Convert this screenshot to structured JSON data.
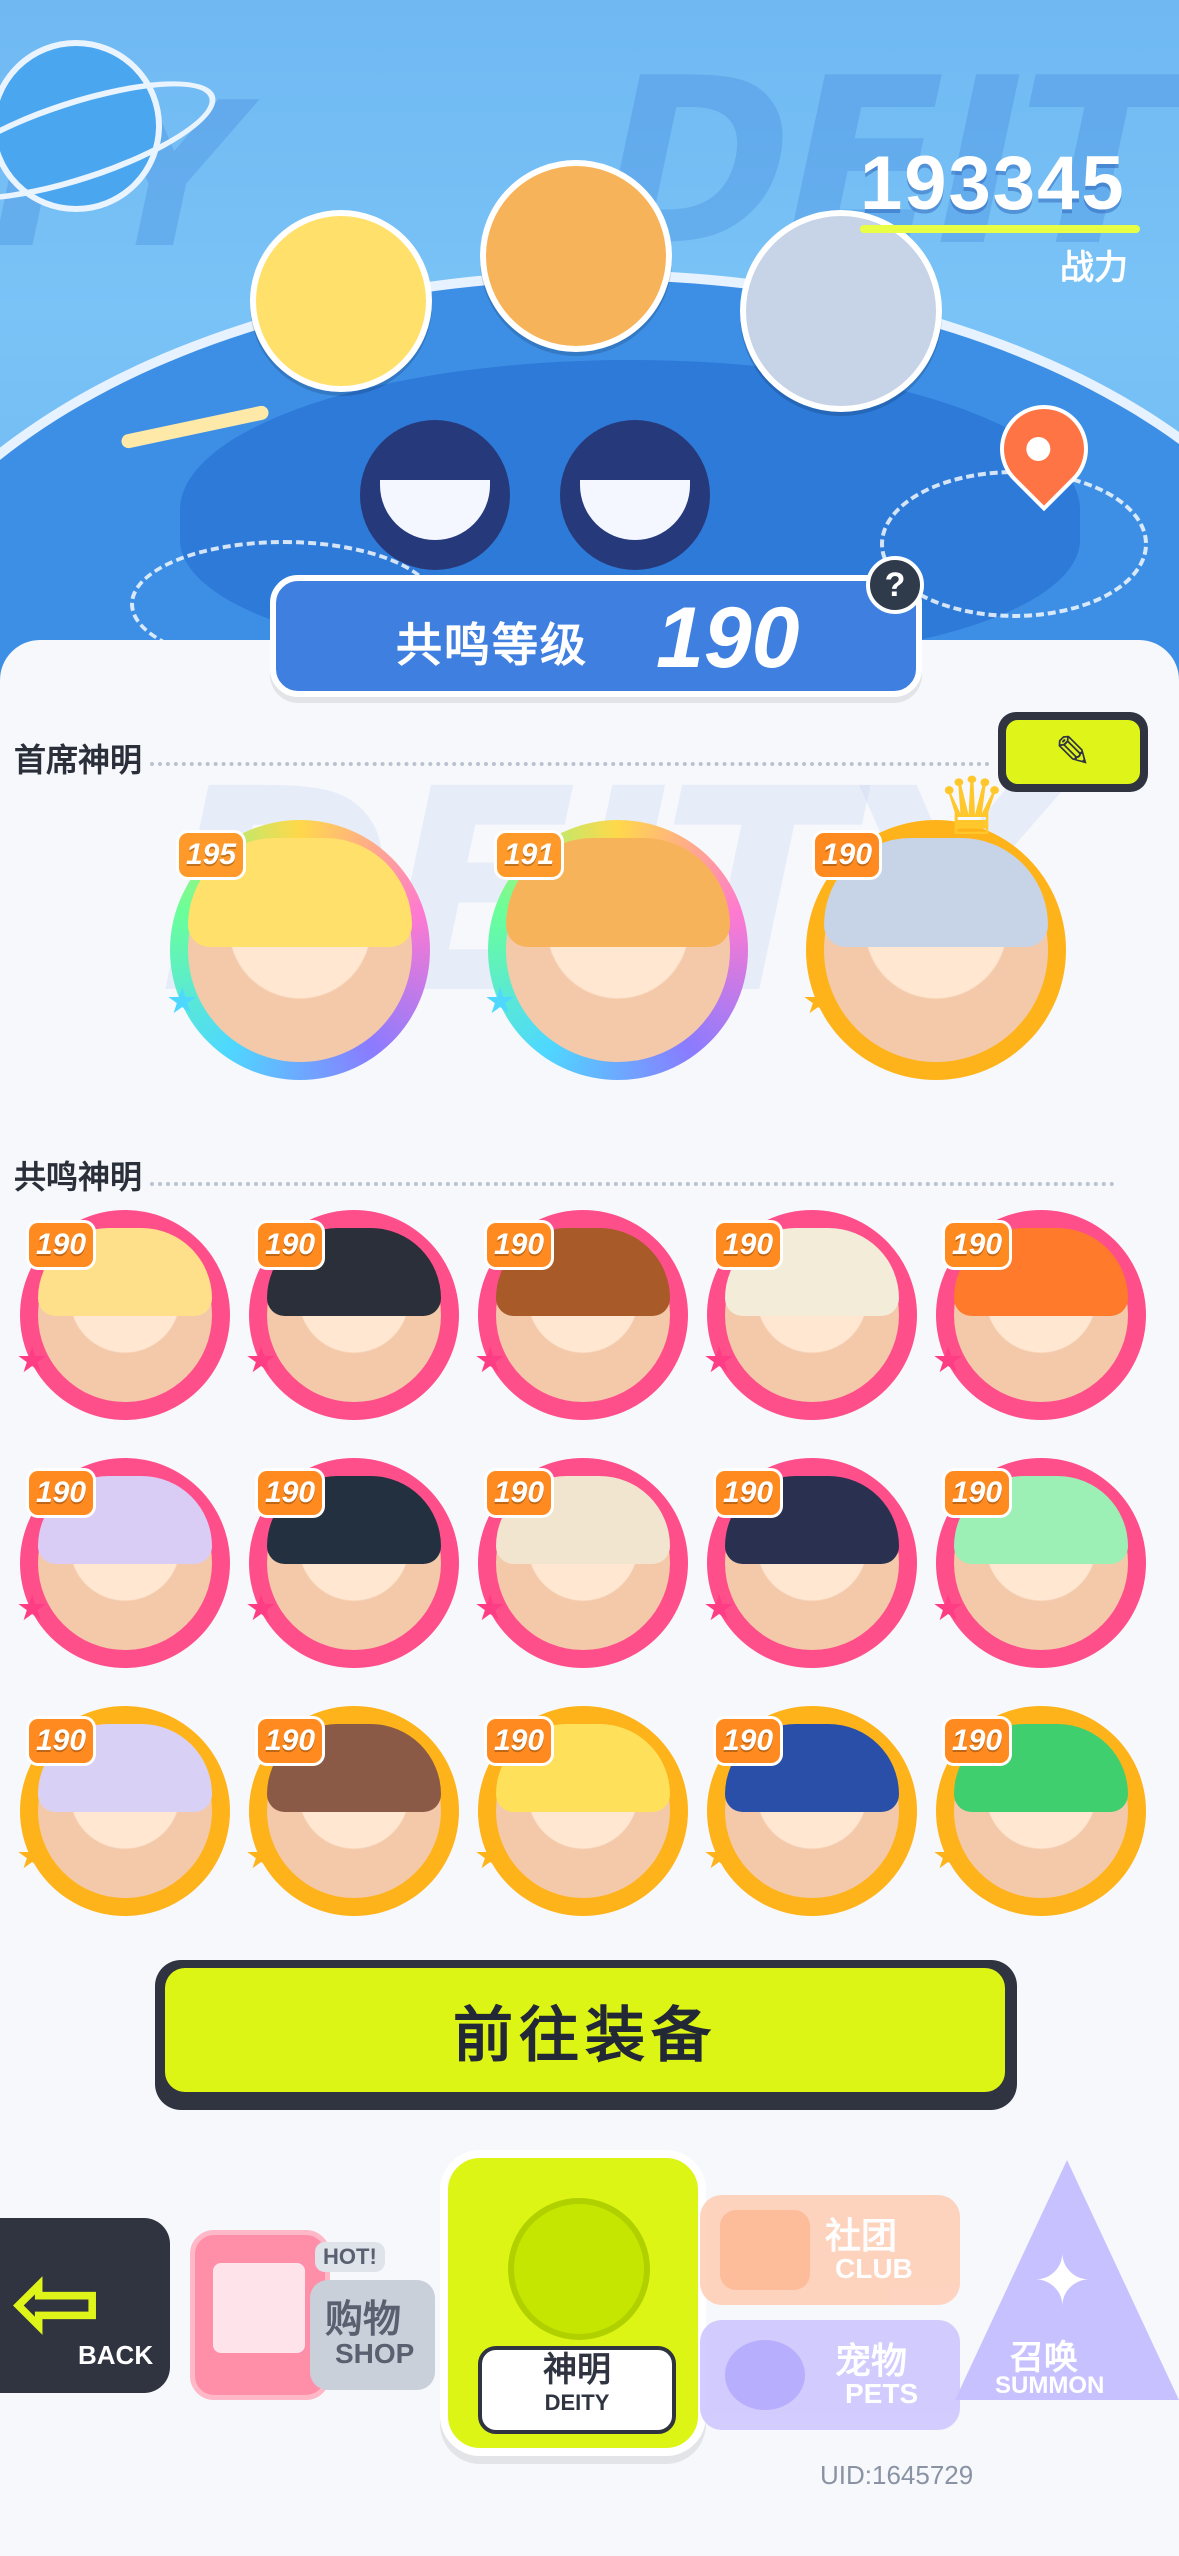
{
  "header": {
    "power_value": "193345",
    "power_label": "战力",
    "resonance_label": "共鸣等级",
    "resonance_level": "190",
    "help_symbol": "?"
  },
  "sections": {
    "lead_title": "首席神明",
    "resonance_title": "共鸣神明"
  },
  "edit_button_symbol": "✎",
  "lead_deities": [
    {
      "level": "195",
      "ring": "rainbow",
      "hair": "#ffe06a"
    },
    {
      "level": "191",
      "ring": "rainbow",
      "hair": "#f7b35a"
    },
    {
      "level": "190",
      "ring": "gold",
      "hair": "#c7d3e6"
    }
  ],
  "resonance_deities": [
    {
      "level": "190",
      "ring": "pink",
      "hair": "#ffe08a"
    },
    {
      "level": "190",
      "ring": "pink",
      "hair": "#2a2f3a"
    },
    {
      "level": "190",
      "ring": "pink",
      "hair": "#a85a28"
    },
    {
      "level": "190",
      "ring": "pink",
      "hair": "#f2ecd8"
    },
    {
      "level": "190",
      "ring": "pink",
      "hair": "#ff7a2a"
    },
    {
      "level": "190",
      "ring": "pink",
      "hair": "#d9cdf5"
    },
    {
      "level": "190",
      "ring": "pink",
      "hair": "#223040"
    },
    {
      "level": "190",
      "ring": "pink",
      "hair": "#f1e5d0"
    },
    {
      "level": "190",
      "ring": "pink",
      "hair": "#2a3050"
    },
    {
      "level": "190",
      "ring": "pink",
      "hair": "#9cf0b5"
    },
    {
      "level": "190",
      "ring": "gold",
      "hair": "#d9d1f5"
    },
    {
      "level": "190",
      "ring": "gold",
      "hair": "#8a5a46"
    },
    {
      "level": "190",
      "ring": "gold",
      "hair": "#ffe05a"
    },
    {
      "level": "190",
      "ring": "gold",
      "hair": "#2a4fa8"
    },
    {
      "level": "190",
      "ring": "gold",
      "hair": "#3fcf6f"
    }
  ],
  "go_equip_label": "前往装备",
  "nav": {
    "back_label": "BACK",
    "shop_hot": "HOT!",
    "shop_cn": "购物",
    "shop_en": "SHOP",
    "deity_cn": "神明",
    "deity_en": "DEITY",
    "club_cn": "社团",
    "club_en": "CLUB",
    "pets_cn": "宠物",
    "pets_en": "PETS",
    "summon_cn": "召唤",
    "summon_en": "SUMMON"
  },
  "uid": "UID:1645729",
  "colors": {
    "accent": "#dcf515",
    "pink_ring": "#ff4f8a",
    "gold_ring": "#ffb31a",
    "sky": "#6fb8f2"
  }
}
